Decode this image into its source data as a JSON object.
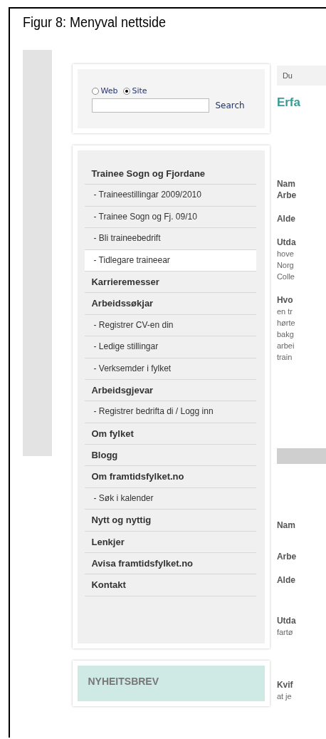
{
  "figure": {
    "title": "Figur 8: Menyval nettside"
  },
  "search": {
    "options": [
      {
        "label": "Web",
        "selected": false
      },
      {
        "label": "Site",
        "selected": true
      }
    ],
    "button": "Search"
  },
  "menu": [
    {
      "label": "Trainee Sogn og Fjordane",
      "kind": "top",
      "selected": false
    },
    {
      "label": "- Traineestillingar 2009/2010",
      "kind": "sub",
      "selected": false
    },
    {
      "label": "- Trainee Sogn og Fj. 09/10",
      "kind": "sub",
      "selected": false
    },
    {
      "label": "- Bli traineebedrift",
      "kind": "sub",
      "selected": false
    },
    {
      "label": "- Tidlegare traineear",
      "kind": "sub",
      "selected": true
    },
    {
      "label": "Karrieremesser",
      "kind": "top",
      "selected": false
    },
    {
      "label": "Arbeidssøkjar",
      "kind": "top",
      "selected": false
    },
    {
      "label": "- Registrer CV-en din",
      "kind": "sub",
      "selected": false
    },
    {
      "label": "- Ledige stillingar",
      "kind": "sub",
      "selected": false
    },
    {
      "label": "- Verksemder i fylket",
      "kind": "sub",
      "selected": false
    },
    {
      "label": "Arbeidsgjevar",
      "kind": "top",
      "selected": false
    },
    {
      "label": "- Registrer bedrifta di / Logg inn",
      "kind": "sub",
      "selected": false
    },
    {
      "label": "Om fylket",
      "kind": "top",
      "selected": false
    },
    {
      "label": "Blogg",
      "kind": "top",
      "selected": false
    },
    {
      "label": "Om framtidsfylket.no",
      "kind": "top",
      "selected": false
    },
    {
      "label": "- Søk i kalender",
      "kind": "sub",
      "selected": false
    },
    {
      "label": "Nytt og nyttig",
      "kind": "top",
      "selected": false
    },
    {
      "label": "Lenkjer",
      "kind": "top",
      "selected": false
    },
    {
      "label": "Avisa framtidsfylket.no",
      "kind": "top",
      "selected": false
    },
    {
      "label": "Kontakt",
      "kind": "top",
      "selected": false
    }
  ],
  "newsletter": {
    "title": "NYHEITSBREV"
  },
  "content": {
    "breadcrumb": "Du",
    "heading": "Erfa",
    "first": [
      {
        "label": "Nam"
      },
      {
        "label": "Arbe"
      },
      {
        "label": "Alde"
      },
      {
        "label": "Utda",
        "lines": [
          "hove",
          "Norg",
          "Colle"
        ]
      },
      {
        "label": "Hvo",
        "lines": [
          "en tr",
          "hørte",
          "bakg",
          "arbei",
          "train"
        ]
      }
    ],
    "second": [
      {
        "label": "Nam"
      },
      {
        "label": "Arbe"
      },
      {
        "label": "Alde"
      },
      {
        "label": "Utda",
        "lines": [
          "fartø"
        ]
      },
      {
        "label": "Kvif",
        "lines": [
          "at je"
        ]
      }
    ]
  }
}
